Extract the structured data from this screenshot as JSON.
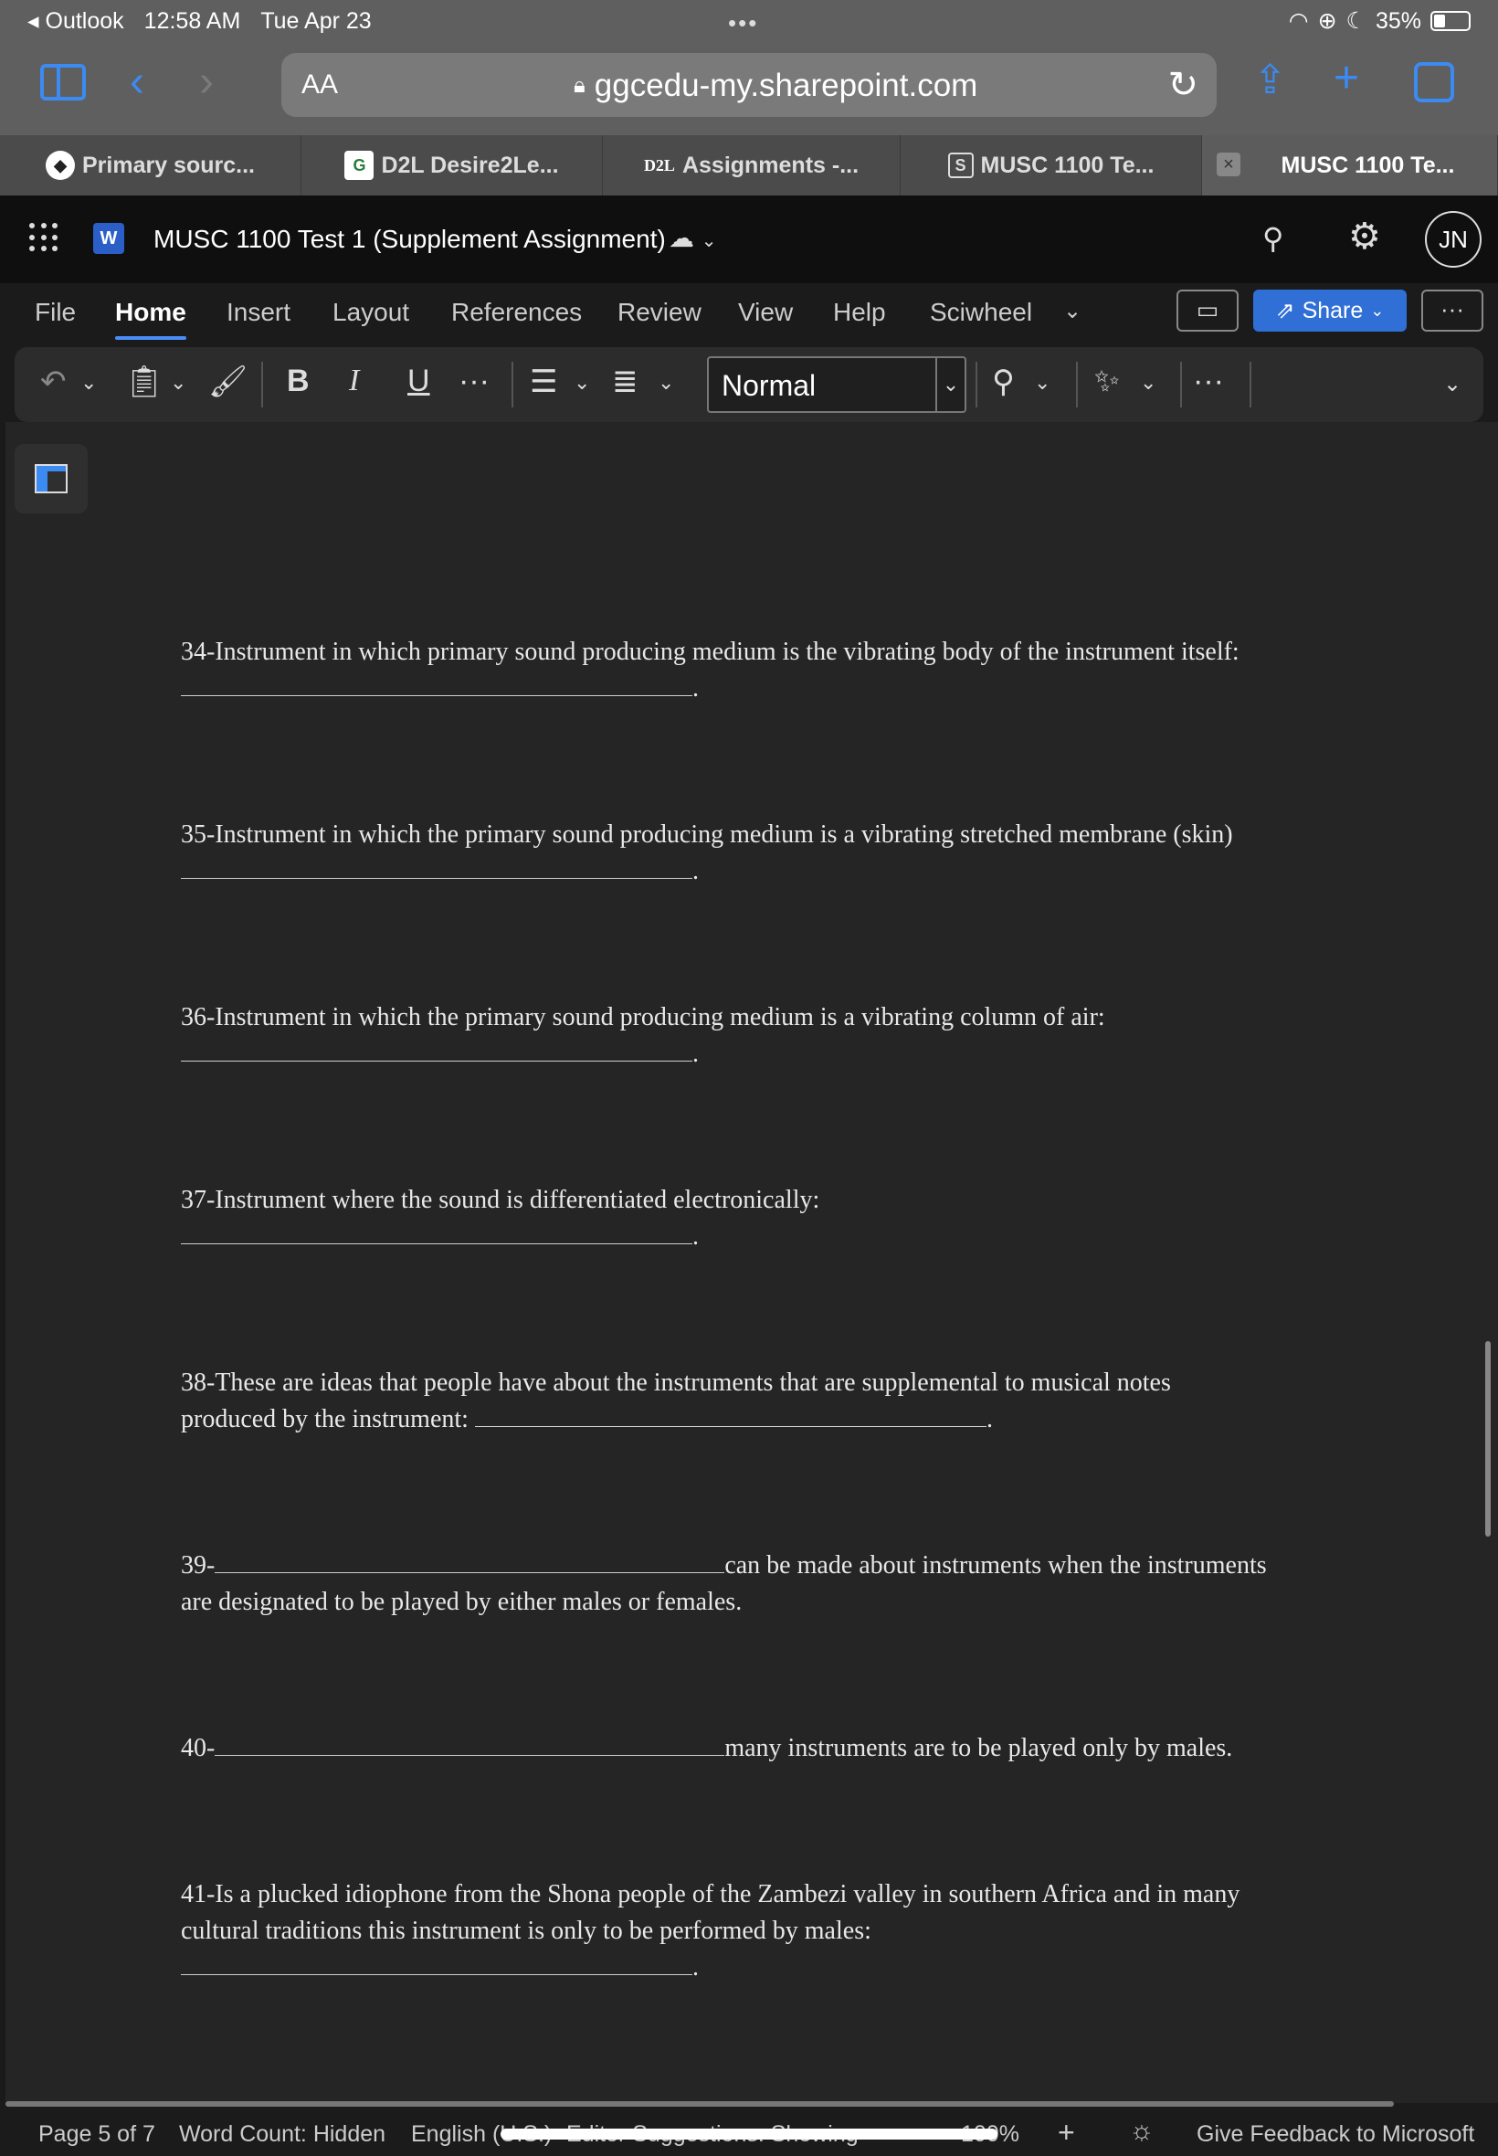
{
  "status_bar": {
    "back_app": "Outlook",
    "time": "12:58 AM",
    "date": "Tue Apr 23",
    "battery": "35%"
  },
  "browser": {
    "text_size_label": "AA",
    "url": "ggcedu-my.sharepoint.com"
  },
  "tabs": [
    {
      "label": "Primary sourc...",
      "icon": "compass-icon"
    },
    {
      "label": "D2L Desire2Le...",
      "icon": "g-logo-icon"
    },
    {
      "label": "Assignments -...",
      "icon": "d2l-logo-icon",
      "icon_text": "D2L"
    },
    {
      "label": "MUSC 1100 Te...",
      "icon": "sharepoint-icon",
      "icon_text": "S"
    },
    {
      "label": "MUSC 1100 Te...",
      "icon": "",
      "active": true
    }
  ],
  "word": {
    "doc_title": "MUSC 1100 Test 1 (Supplement Assignment)",
    "avatar_initials": "JN",
    "logo_text": "W"
  },
  "ribbon_tabs": [
    "File",
    "Home",
    "Insert",
    "Layout",
    "References",
    "Review",
    "View",
    "Help",
    "Sciwheel"
  ],
  "share_label": "Share",
  "toolbar": {
    "bold": "B",
    "italic": "I",
    "underline": "U",
    "style_value": "Normal"
  },
  "questions": [
    {
      "text": "34-Instrument in which primary sound producing medium is the vibrating body of the instrument itself:"
    },
    {
      "text": "35-Instrument in which the primary sound producing medium is a vibrating stretched membrane (skin)"
    },
    {
      "text": "36-Instrument in which the primary sound producing medium is a vibrating column of air:"
    },
    {
      "text": "37-Instrument where the sound is differentiated electronically:"
    },
    {
      "text_line1": "38-These are ideas that people have about the instruments that are supplemental to musical notes",
      "text_line2": "produced by the instrument:"
    },
    {
      "prefix": "39-",
      "suffix": "can be made about instruments when the instruments",
      "text_line2": "are designated to be played by either males or females."
    },
    {
      "prefix": "40-",
      "suffix": "many instruments are to be played only by males."
    },
    {
      "text_line1": "41-Is a plucked idiophone from the Shona people of the Zambezi valley in southern Africa and in many",
      "text_line2": "cultural traditions this instrument is only to be performed by males:"
    }
  ],
  "footer": {
    "page": "Page 5 of 7",
    "word_count": "Word Count: Hidden",
    "language": "English (U.S.)",
    "editor": "Editor Suggestions: Showing",
    "zoom": "100%",
    "feedback": "Give Feedback to Microsoft"
  }
}
